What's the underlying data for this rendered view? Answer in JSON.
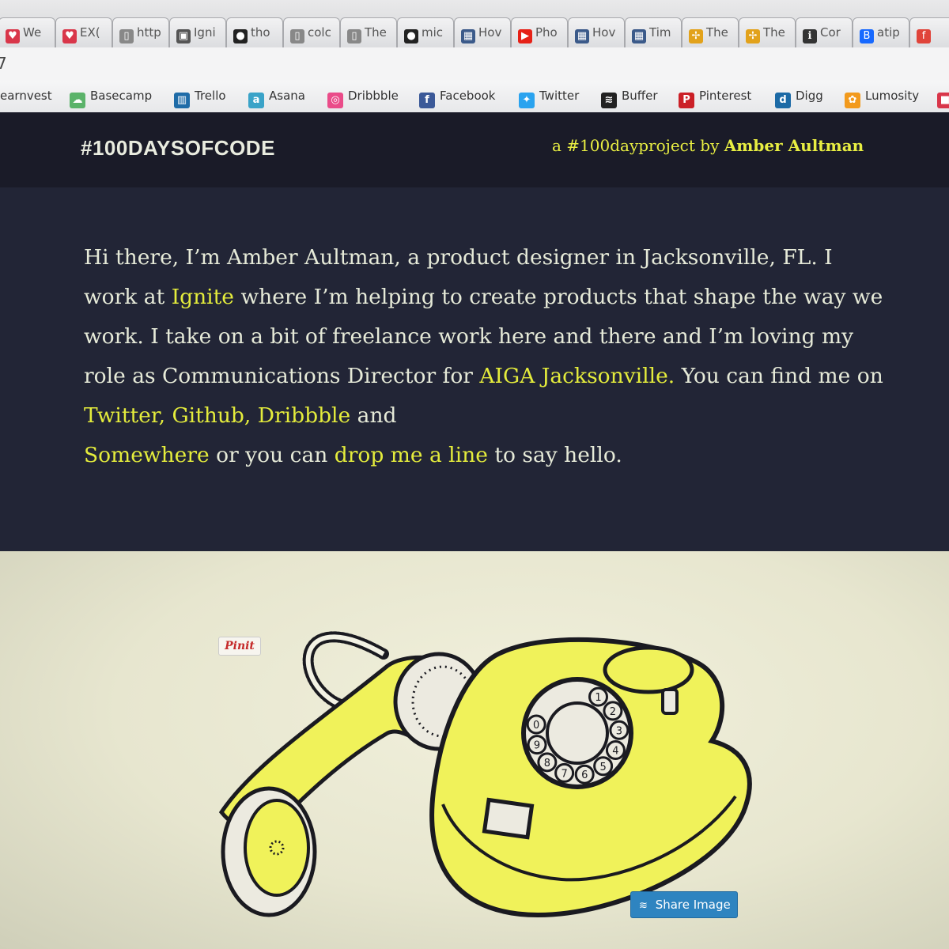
{
  "browser": {
    "tabs": [
      {
        "label": "We",
        "icon": "heart-icon",
        "color": "#d9364a"
      },
      {
        "label": "EX(",
        "icon": "heart-icon",
        "color": "#d9364a"
      },
      {
        "label": "http",
        "icon": "page-icon",
        "color": "#888888"
      },
      {
        "label": "Igni",
        "icon": "image-icon",
        "color": "#555555"
      },
      {
        "label": "tho",
        "icon": "github-icon",
        "color": "#222222"
      },
      {
        "label": "colc",
        "icon": "page-icon",
        "color": "#888888"
      },
      {
        "label": "The",
        "icon": "page-icon",
        "color": "#888888"
      },
      {
        "label": "mic",
        "icon": "github-icon",
        "color": "#222222"
      },
      {
        "label": "Hov",
        "icon": "grid-icon",
        "color": "#3b5a8a"
      },
      {
        "label": "Pho",
        "icon": "youtube-icon",
        "color": "#e62117"
      },
      {
        "label": "Hov",
        "icon": "grid-icon",
        "color": "#3b5a8a"
      },
      {
        "label": "Tim",
        "icon": "grid-icon",
        "color": "#3b5a8a"
      },
      {
        "label": "The",
        "icon": "pinwheel-icon",
        "color": "#e2a21b"
      },
      {
        "label": "The",
        "icon": "pinwheel-icon",
        "color": "#e2a21b"
      },
      {
        "label": "Cor",
        "icon": "info-icon",
        "color": "#333333"
      },
      {
        "label": "atip",
        "icon": "behance-icon",
        "color": "#1769ff"
      },
      {
        "label": "",
        "icon": "facebook-icon",
        "color": "#e0443a"
      }
    ],
    "url_fragment": "7",
    "bookmarks": [
      {
        "label": "earnvest",
        "icon": "",
        "color": ""
      },
      {
        "label": "Basecamp",
        "icon": "basecamp-icon",
        "color": "#5bb36a"
      },
      {
        "label": "Trello",
        "icon": "trello-icon",
        "color": "#1f6ca8"
      },
      {
        "label": "Asana",
        "icon": "asana-icon",
        "color": "#3aa3c8"
      },
      {
        "label": "Dribbble",
        "icon": "dribbble-icon",
        "color": "#ea4c89"
      },
      {
        "label": "Facebook",
        "icon": "facebook-icon",
        "color": "#3b5998"
      },
      {
        "label": "Twitter",
        "icon": "twitter-icon",
        "color": "#2aa3ef"
      },
      {
        "label": "Buffer",
        "icon": "buffer-icon",
        "color": "#222222"
      },
      {
        "label": "Pinterest",
        "icon": "pinterest-icon",
        "color": "#cb2027"
      },
      {
        "label": "Digg",
        "icon": "digg-icon",
        "color": "#1c6aa6"
      },
      {
        "label": "Lumosity",
        "icon": "lumosity-icon",
        "color": "#f29a1d"
      },
      {
        "label": "",
        "icon": "bookmark-icon",
        "color": "#d9364a"
      }
    ]
  },
  "header": {
    "title": "#100DAYSOFCODE",
    "byline_prefix": "a #100dayproject by",
    "byline_author": "Amber Aultman"
  },
  "intro": {
    "p1": "Hi there, I’m Amber Aultman, a product designer in Jacksonville, FL. I work at",
    "link_ignite": "Ignite",
    "p2": "where I’m helping to create products that shape the way we work. I take on a bit of freelance work here and there and I’m loving my role as Communications Director for",
    "link_aiga": "AIGA Jacksonville.",
    "p3": "You can find me on",
    "link_twitter": "Twitter,",
    "link_github": "Github,",
    "link_dribbble": "Dribbble",
    "p4": "and",
    "link_somewhere": "Somewhere",
    "p5": "or you can",
    "link_contact": "drop me a line",
    "p6": "to say hello."
  },
  "image": {
    "pin_label": "Pinit",
    "share_label": "Share Image",
    "dial_digits": [
      "1",
      "2",
      "3",
      "4",
      "5",
      "6",
      "7",
      "8",
      "9",
      "0"
    ],
    "colors": {
      "phone": "#f0f25a",
      "outline": "#1a1a20",
      "accent": "#e4ec3c"
    }
  }
}
